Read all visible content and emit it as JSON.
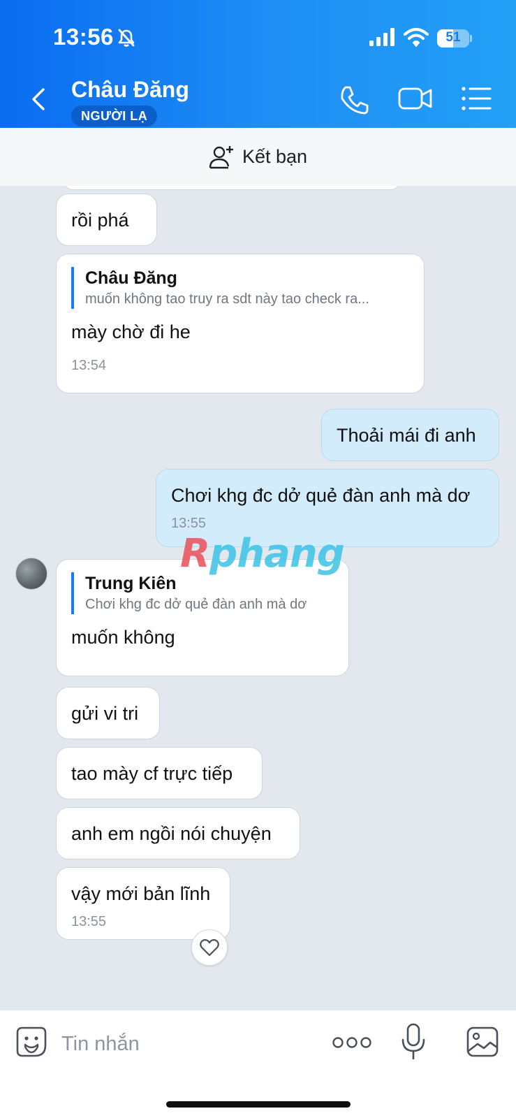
{
  "status_bar": {
    "time": "13:56",
    "battery": "51",
    "battery_level": 0.51
  },
  "header": {
    "contact_name": "Châu Đăng",
    "badge": "NGƯỜI LẠ",
    "icons": {
      "back": "chevron-left-icon",
      "call": "phone-icon",
      "video": "video-camera-icon",
      "menu": "list-menu-icon"
    }
  },
  "friend_bar": {
    "label": "Kết bạn",
    "icon": "add-user-icon"
  },
  "messages": [
    {
      "direction": "in",
      "text": "rồi phá"
    },
    {
      "direction": "in",
      "quote": {
        "author": "Châu Đăng",
        "text": "muốn không tao truy ra sdt này tao check ra..."
      },
      "text": "mày chờ đi he",
      "time": "13:54"
    },
    {
      "direction": "out",
      "text": "Thoải mái đi anh"
    },
    {
      "direction": "out",
      "text": "Chơi khg đc dở quẻ đàn anh mà dơ",
      "time": "13:55"
    },
    {
      "direction": "in",
      "quote": {
        "author": "Trung Kiên",
        "text": "Chơi khg đc dở quẻ đàn anh mà dơ"
      },
      "text": "muốn không"
    },
    {
      "direction": "in",
      "text": "gửi vi tri"
    },
    {
      "direction": "in",
      "text": "tao mày cf trực tiếp"
    },
    {
      "direction": "in",
      "text": "anh em ngồi nói chuyện"
    },
    {
      "direction": "in",
      "text": "vậy mới bản lĩnh",
      "time": "13:55"
    }
  ],
  "watermark": {
    "first": "R",
    "rest": "phang"
  },
  "composer": {
    "placeholder": "Tin nhắn",
    "icons": {
      "emoji": "sticker-icon",
      "more": "more-dots-icon",
      "mic": "microphone-icon",
      "image": "image-icon"
    }
  },
  "colors": {
    "header_start": "#0a6cf0",
    "header_end": "#21a0f6",
    "outgoing_bubble": "#d3ecfc",
    "chat_background": "#e3e8ef",
    "accent": "#1a7af2"
  }
}
